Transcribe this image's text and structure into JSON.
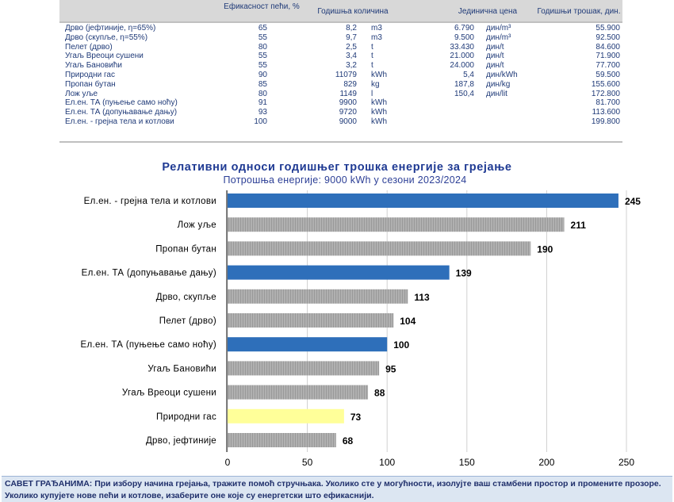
{
  "table": {
    "headers": {
      "efficiency": "Ефикасност пећи, %",
      "quantity": "Годишња количина",
      "unit_price": "Јединична цена",
      "annual_cost": "Годишњи трошак, дин."
    },
    "rows": [
      {
        "label": "Дрво  (јефтиније, η=65%)",
        "efficiency": "65",
        "quantity": "8,2",
        "unit": "m3",
        "price": "6.790",
        "price_unit": "дин/m³",
        "cost": "55.900"
      },
      {
        "label": "Дрво  (скупље, η=55%)",
        "efficiency": "55",
        "quantity": "9,7",
        "unit": "m3",
        "price": "9.500",
        "price_unit": "дин/m³",
        "cost": "92.500"
      },
      {
        "label": "Пелет (дрво)",
        "efficiency": "80",
        "quantity": "2,5",
        "unit": "t",
        "price": "33.430",
        "price_unit": "дин/t",
        "cost": "84.600"
      },
      {
        "label": "Угаљ Вреоци сушени",
        "efficiency": "55",
        "quantity": "3,4",
        "unit": "t",
        "price": "21.000",
        "price_unit": "дин/t",
        "cost": "71.900"
      },
      {
        "label": "Угаљ Бановићи",
        "efficiency": "55",
        "quantity": "3,2",
        "unit": "t",
        "price": "24.000",
        "price_unit": "дин/t",
        "cost": "77.700"
      },
      {
        "label": "Природни гас",
        "efficiency": "90",
        "quantity": "11079",
        "unit": "kWh",
        "price": "5,4",
        "price_unit": "дин/kWh",
        "cost": "59.500"
      },
      {
        "label": "Пропан бутан",
        "efficiency": "85",
        "quantity": "829",
        "unit": "kg",
        "price": "187,8",
        "price_unit": "дин/kg",
        "cost": "155.600"
      },
      {
        "label": "Лож уље",
        "efficiency": "80",
        "quantity": "1149",
        "unit": "l",
        "price": "150,4",
        "price_unit": "дин/lit",
        "cost": "172.800"
      },
      {
        "label": "Ел.ен. ТА (пуњење само ноћу)",
        "efficiency": "91",
        "quantity": "9900",
        "unit": "kWh",
        "price": "",
        "price_unit": "",
        "cost": "81.700"
      },
      {
        "label": "Ел.ен. ТА (допуњавање дању)",
        "efficiency": "93",
        "quantity": "9720",
        "unit": "kWh",
        "price": "",
        "price_unit": "",
        "cost": "113.600"
      },
      {
        "label": "Ел.ен. - грејна тела и котлови",
        "efficiency": "100",
        "quantity": "9000",
        "unit": "kWh",
        "price": "",
        "price_unit": "",
        "cost": "199.800"
      }
    ]
  },
  "chart_data": {
    "type": "bar",
    "orientation": "horizontal",
    "title": "Релативни односи годишњег трошка енергије за грејање",
    "subtitle": "Потрошња енергије: 9000 kWh у сезони 2023/2024",
    "categories": [
      "Ел.ен. - грејна тела и котлови",
      "Лож уље",
      "Пропан бутан",
      "Ел.ен. ТА (допуњавање дању)",
      "Дрво, скупље",
      "Пелет (дрво)",
      "Ел.ен. ТА (пуњење само ноћу)",
      "Угаљ Бановићи",
      "Угаљ Вреоци сушени",
      "Природни гас",
      "Дрво, јефтиније"
    ],
    "values": [
      245,
      211,
      190,
      139,
      113,
      104,
      100,
      95,
      88,
      73,
      68
    ],
    "bar_colors": [
      "#2e6fba",
      "#a6a6a6",
      "#a6a6a6",
      "#2e6fba",
      "#a6a6a6",
      "#a6a6a6",
      "#2e6fba",
      "#a6a6a6",
      "#a6a6a6",
      "#ffff99",
      "#a6a6a6"
    ],
    "xlim": [
      0,
      250
    ],
    "xticks": [
      "0",
      "50",
      "100",
      "150",
      "200",
      "250"
    ],
    "grid": true,
    "data_labels": true
  },
  "advice": "САВЕТ ГРАЂАНИМА: При избору начина грејања, тражите помоћ стручњака. Уколико сте у могућности, изолујте ваш стамбени простор и промените прозоре. Уколико купујете нове пећи и котлове, изаберите оне које су енергетски што ефикаснији."
}
